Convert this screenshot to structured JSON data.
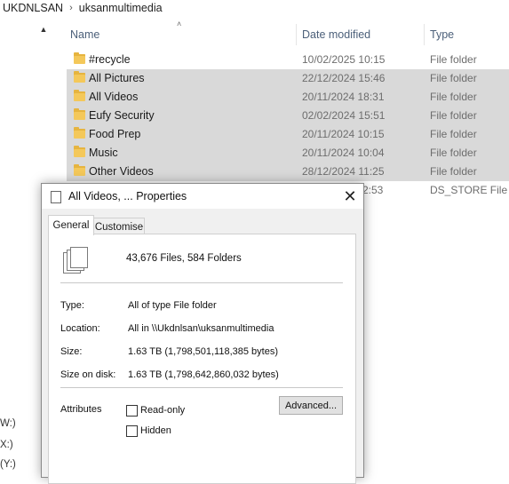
{
  "breadcrumb": {
    "items": [
      "UKDNLSAN",
      "uksanmultimedia"
    ],
    "separator_icon": "chevron-right-icon"
  },
  "nav": {
    "scroll_up_icon": "chevron-up-icon",
    "drives": [
      "W:)",
      "X:)",
      "(Y:)"
    ]
  },
  "columns": {
    "name": "Name",
    "date": "Date modified",
    "type": "Type",
    "sort_icon": "sort-ascending-icon"
  },
  "files": [
    {
      "name": "#recycle",
      "date": "10/02/2025 10:15",
      "type": "File folder",
      "icon": "folder-icon",
      "selected": false
    },
    {
      "name": "All Pictures",
      "date": "22/12/2024 15:46",
      "type": "File folder",
      "icon": "folder-icon",
      "selected": true
    },
    {
      "name": "All Videos",
      "date": "20/11/2024 18:31",
      "type": "File folder",
      "icon": "folder-icon",
      "selected": true
    },
    {
      "name": "Eufy Security",
      "date": "02/02/2024 15:51",
      "type": "File folder",
      "icon": "folder-icon",
      "selected": true
    },
    {
      "name": "Food Prep",
      "date": "20/11/2024 10:15",
      "type": "File folder",
      "icon": "folder-icon",
      "selected": true
    },
    {
      "name": "Music",
      "date": "20/11/2024 10:04",
      "type": "File folder",
      "icon": "folder-icon",
      "selected": true
    },
    {
      "name": "Other Videos",
      "date": "28/12/2024 11:25",
      "type": "File folder",
      "icon": "folder-icon",
      "selected": true
    },
    {
      "name": "",
      "date": "2:53",
      "type": "DS_STORE File",
      "icon": "",
      "selected": false
    }
  ],
  "dialog": {
    "title": "All Videos, ... Properties",
    "title_icon": "properties-icon",
    "close_label": "✕",
    "tabs": {
      "general": "General",
      "customise": "Customise"
    },
    "summary_icon": "multiple-files-icon",
    "count": "43,676 Files, 584 Folders",
    "props": [
      {
        "label": "Type:",
        "value": "All of type File folder"
      },
      {
        "label": "Location:",
        "value": "All in \\\\Ukdnlsan\\uksanmultimedia"
      },
      {
        "label": "Size:",
        "value": "1.63 TB (1,798,501,118,385 bytes)"
      },
      {
        "label": "Size on disk:",
        "value": "1.63 TB (1,798,642,860,032 bytes)"
      }
    ],
    "attributes_label": "Attributes",
    "readonly_label": "Read-only",
    "hidden_label": "Hidden",
    "advanced_label": "Advanced..."
  },
  "colors": {
    "selection": "#d9d9d9",
    "folder": "#f4c85a",
    "header_text": "#4c607a",
    "dialog_bg": "#f0f0f0"
  }
}
